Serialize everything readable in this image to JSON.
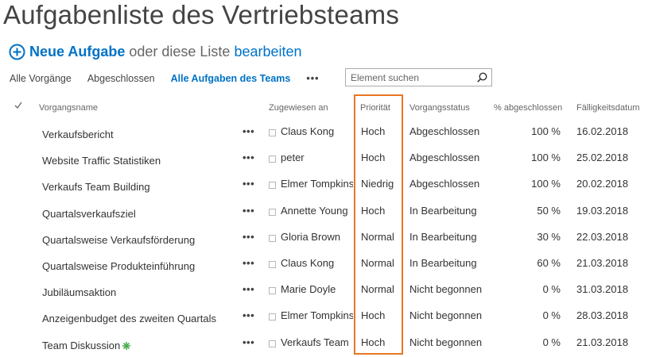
{
  "page": {
    "title": "Aufgabenliste des Vertriebsteams",
    "new_task": "Neue Aufgabe",
    "or_text": "oder diese Liste",
    "edit_link": "bearbeiten"
  },
  "views": [
    "Alle Vorgänge",
    "Abgeschlossen",
    "Alle Aufgaben des Teams"
  ],
  "views_more": "•••",
  "search": {
    "placeholder": "Element suchen"
  },
  "columns": {
    "name": "Vorgangsname",
    "assigned": "Zugewiesen an",
    "priority": "Priorität",
    "status": "Vorgangsstatus",
    "pct": "% abgeschlossen",
    "due": "Fälligkeitsdatum"
  },
  "row_menu": "•••",
  "rows": [
    {
      "name": "Verkaufsbericht",
      "assigned": "Claus Kong",
      "priority": "Hoch",
      "status": "Abgeschlossen",
      "pct": "100 %",
      "due": "16.02.2018"
    },
    {
      "name": "Website Traffic Statistiken",
      "assigned": "peter",
      "priority": "Hoch",
      "status": "Abgeschlossen",
      "pct": "100 %",
      "due": "25.02.2018"
    },
    {
      "name": "Verkaufs Team Building",
      "assigned": "Elmer Tompkins",
      "priority": "Niedrig",
      "status": "Abgeschlossen",
      "pct": "100 %",
      "due": "20.02.2018"
    },
    {
      "name": "Quartalsverkaufsziel",
      "assigned": "Annette Young",
      "priority": "Hoch",
      "status": "In Bearbeitung",
      "pct": "50 %",
      "due": "19.03.2018"
    },
    {
      "name": "Quartalsweise Verkaufsförderung",
      "assigned": "Gloria Brown",
      "priority": "Normal",
      "status": "In Bearbeitung",
      "pct": "30 %",
      "due": "22.03.2018"
    },
    {
      "name": "Quartalsweise Produkteinführung",
      "assigned": "Claus Kong",
      "priority": "Normal",
      "status": "In Bearbeitung",
      "pct": "60 %",
      "due": "21.03.2018"
    },
    {
      "name": "Jubiläumsaktion",
      "assigned": "Marie Doyle",
      "priority": "Normal",
      "status": "Nicht begonnen",
      "pct": "0 %",
      "due": "31.03.2018"
    },
    {
      "name": "Anzeigenbudget des zweiten Quartals",
      "assigned": "Elmer Tompkins",
      "priority": "Hoch",
      "status": "Nicht begonnen",
      "pct": "0 %",
      "due": "28.03.2018"
    },
    {
      "name": "Team Diskussion",
      "assigned": "Verkaufs Team",
      "priority": "Hoch",
      "status": "Nicht begonnen",
      "pct": "0 %",
      "due": "21.03.2018",
      "is_new": true
    }
  ],
  "colors": {
    "accent": "#0072c6",
    "highlight": "#e87722",
    "new_badge": "#4caf50"
  },
  "icons": {
    "add": "plus-circle-icon",
    "search": "search-icon",
    "new": "new-item-icon",
    "select": "checkmark-icon"
  }
}
